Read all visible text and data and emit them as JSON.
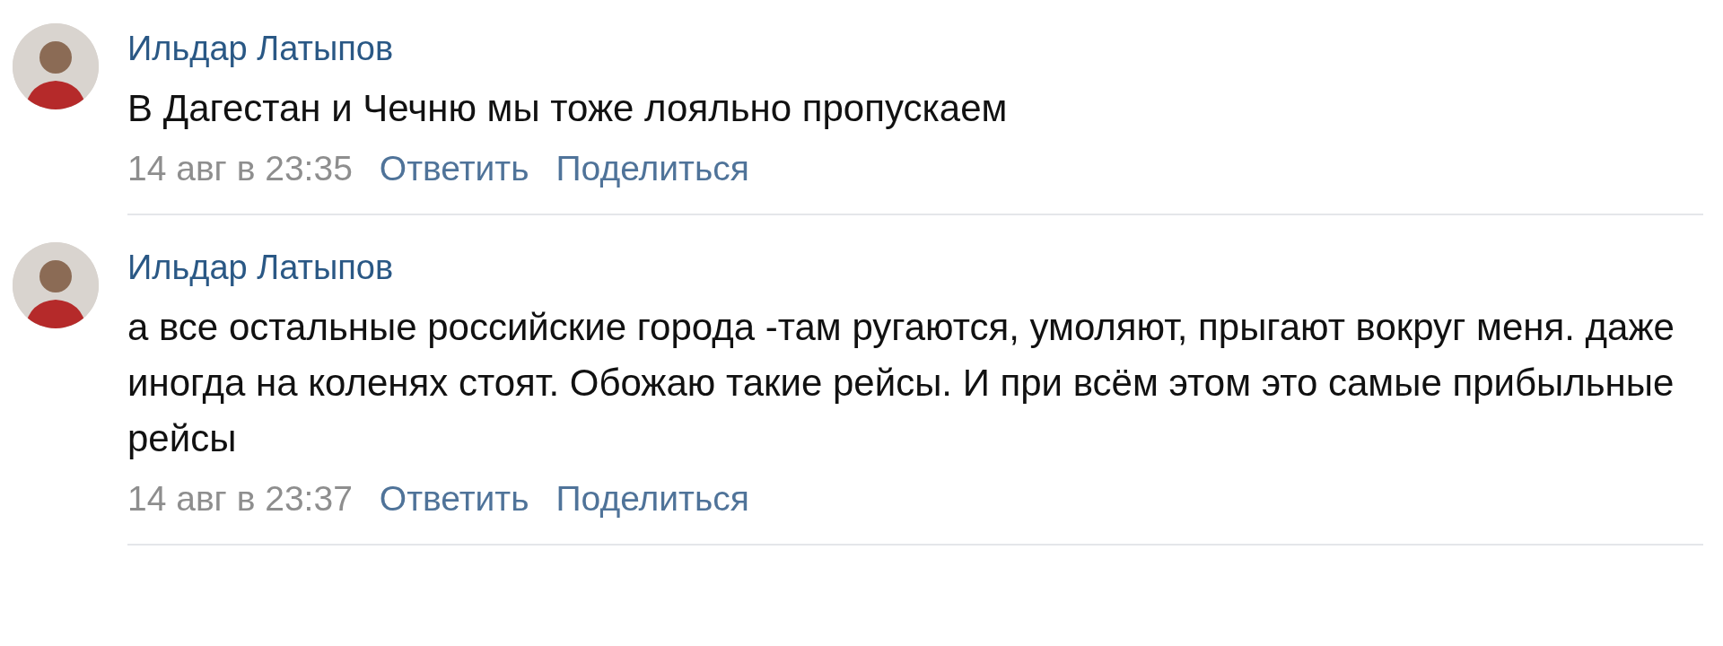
{
  "comments": [
    {
      "author": "Ильдар Латыпов",
      "text": "В Дагестан и Чечню мы тоже лояльно пропускаем",
      "date": "14 авг в 23:35",
      "actions": [
        "Ответить",
        "Поделиться"
      ]
    },
    {
      "author": "Ильдар Латыпов",
      "text": "а все остальные российские города -там ругаются, умоляют, прыгают вокруг меня. даже иногда на коленях стоят. Обожаю такие рейсы. И при всём этом это самые прибыльные рейсы",
      "date": "14 авг в 23:37",
      "actions": [
        "Ответить",
        "Поделиться"
      ]
    }
  ]
}
